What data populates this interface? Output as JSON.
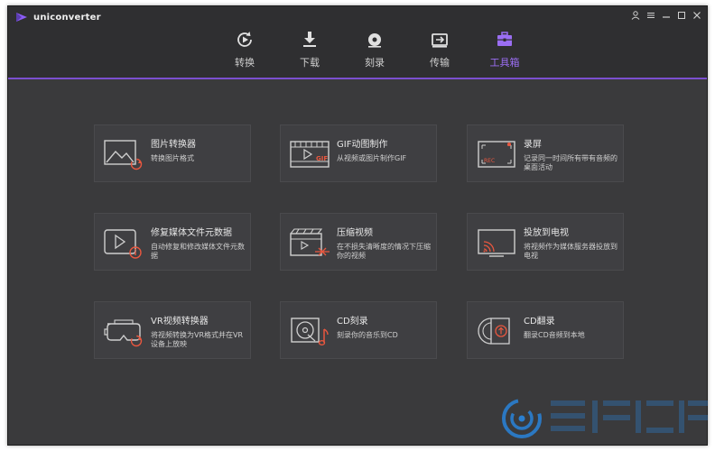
{
  "app": {
    "name": "uniconverter"
  },
  "colors": {
    "accent": "#9b6ef3",
    "icon_orange": "#e9573f"
  },
  "tabs": [
    {
      "label": "转换",
      "icon": "convert-icon"
    },
    {
      "label": "下载",
      "icon": "download-icon"
    },
    {
      "label": "刻录",
      "icon": "burn-disc-icon"
    },
    {
      "label": "传输",
      "icon": "transfer-icon"
    },
    {
      "label": "工具箱",
      "icon": "toolbox-icon",
      "active": true
    }
  ],
  "tools": [
    {
      "title": "图片转换器",
      "desc": "转换图片格式",
      "icon": "image-convert-icon"
    },
    {
      "title": "GIF动图制作",
      "desc": "从视频或图片制作GIF",
      "icon": "gif-maker-icon"
    },
    {
      "title": "录屏",
      "desc": "记录同一时间所有带有音频的桌面活动",
      "icon": "screen-record-icon"
    },
    {
      "title": "修复媒体文件元数据",
      "desc": "自动修复和修改媒体文件元数据",
      "icon": "metadata-fix-icon"
    },
    {
      "title": "压缩视频",
      "desc": "在不损失清晰度的情况下压缩你的视频",
      "icon": "compress-video-icon"
    },
    {
      "title": "投放到电视",
      "desc": "将视频作为媒体服务器投放到电视",
      "icon": "cast-tv-icon"
    },
    {
      "title": "VR视频转换器",
      "desc": "将视频转换为VR格式并在VR设备上放映",
      "icon": "vr-convert-icon"
    },
    {
      "title": "CD刻录",
      "desc": "刻录你的音乐到CD",
      "icon": "cd-burn-icon"
    },
    {
      "title": "CD翻录",
      "desc": "翻录CD音频到本地",
      "icon": "cd-rip-icon"
    }
  ]
}
